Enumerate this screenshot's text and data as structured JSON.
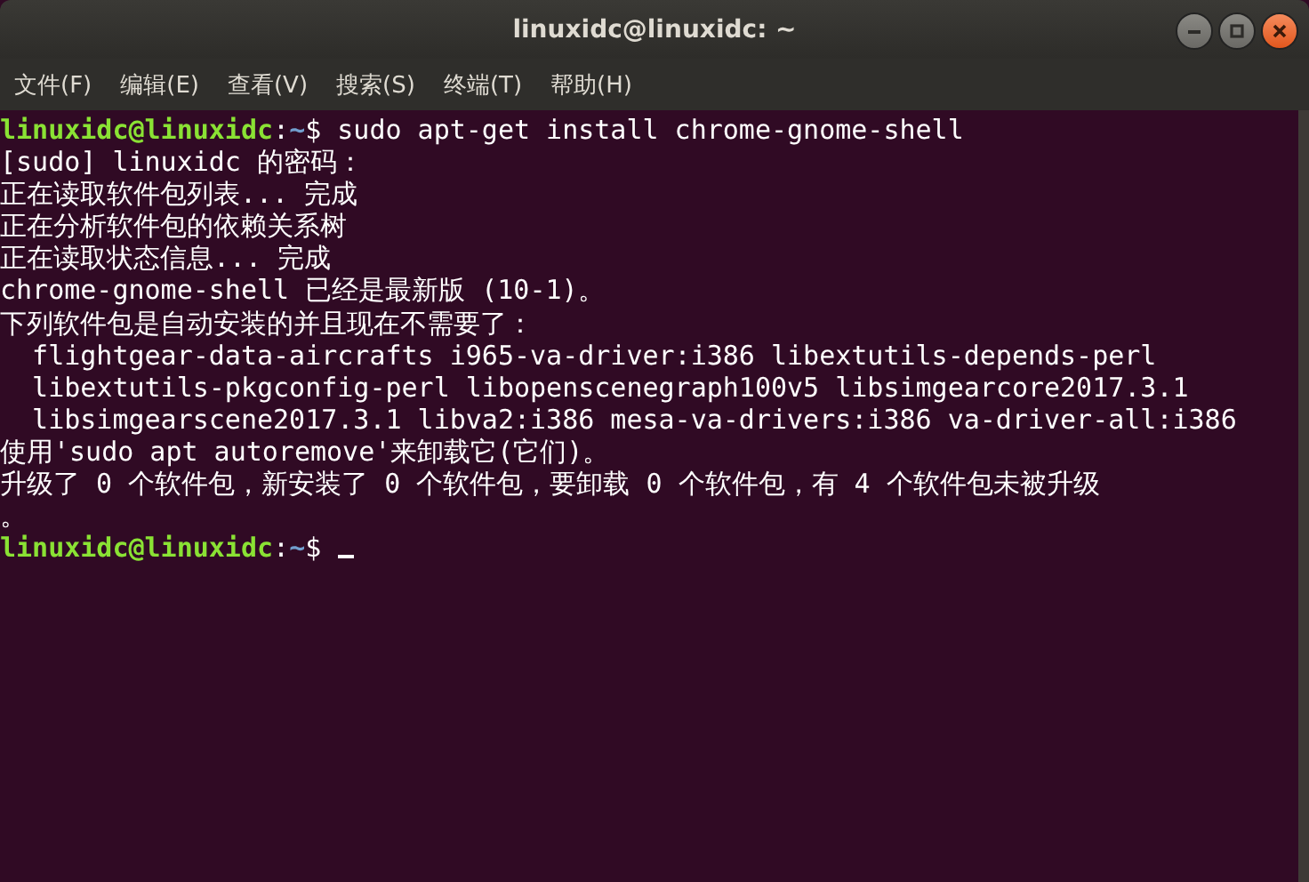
{
  "window": {
    "title": "linuxidc@linuxidc: ~"
  },
  "menu": [
    "文件(F)",
    "编辑(E)",
    "查看(V)",
    "搜索(S)",
    "终端(T)",
    "帮助(H)"
  ],
  "terminal": {
    "lines": [
      {
        "kind": "prompt",
        "user_host": "linuxidc@linuxidc",
        "separator": ":",
        "path": "~",
        "command": "$ sudo apt-get install chrome-gnome-shell",
        "cursor": false
      },
      {
        "kind": "output",
        "text": "[sudo] linuxidc 的密码："
      },
      {
        "kind": "output",
        "text": "正在读取软件包列表... 完成"
      },
      {
        "kind": "output",
        "text": "正在分析软件包的依赖关系树"
      },
      {
        "kind": "output",
        "text": "正在读取状态信息... 完成"
      },
      {
        "kind": "output",
        "text": "chrome-gnome-shell 已经是最新版 (10-1)。"
      },
      {
        "kind": "output",
        "text": "下列软件包是自动安装的并且现在不需要了："
      },
      {
        "kind": "output",
        "text": "  flightgear-data-aircrafts i965-va-driver:i386 libextutils-depends-perl"
      },
      {
        "kind": "output",
        "text": "  libextutils-pkgconfig-perl libopenscenegraph100v5 libsimgearcore2017.3.1"
      },
      {
        "kind": "output",
        "text": "  libsimgearscene2017.3.1 libva2:i386 mesa-va-drivers:i386 va-driver-all:i386"
      },
      {
        "kind": "output",
        "text": "使用'sudo apt autoremove'来卸载它(它们)。"
      },
      {
        "kind": "output",
        "text": "升级了 0 个软件包，新安装了 0 个软件包，要卸载 0 个软件包，有 4 个软件包未被升级"
      },
      {
        "kind": "output",
        "text": "。"
      },
      {
        "kind": "prompt",
        "user_host": "linuxidc@linuxidc",
        "separator": ":",
        "path": "~",
        "command": "$ ",
        "cursor": true
      }
    ]
  }
}
